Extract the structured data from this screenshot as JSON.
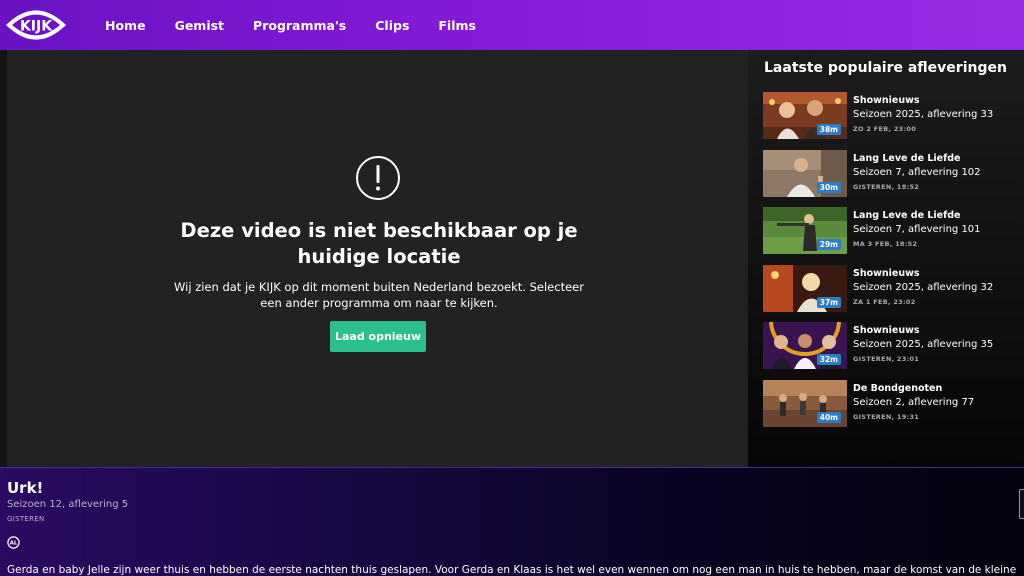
{
  "header": {
    "logo_icon": "kijk-logo",
    "nav": [
      "Home",
      "Gemist",
      "Programma's",
      "Clips",
      "Films"
    ]
  },
  "player": {
    "error_icon": "exclamation-circle-icon",
    "title": "Deze video is niet beschikbaar op je huidige locatie",
    "message": "Wij zien dat je KIJK op dit moment buiten Nederland bezoekt. Selecteer een ander programma om naar te kijken.",
    "button": "Laad opnieuw",
    "button_color": "#2bbf8e"
  },
  "sidebar": {
    "title": "Laatste populaire afleveringen",
    "episodes": [
      {
        "show": "Shownieuws",
        "season": "Seizoen 2025, aflevering 33",
        "date": "ZO 2 FEB, 23:00",
        "duration": "38m"
      },
      {
        "show": "Lang Leve de Liefde",
        "season": "Seizoen 7, aflevering 102",
        "date": "GISTEREN, 18:52",
        "duration": "30m"
      },
      {
        "show": "Lang Leve de Liefde",
        "season": "Seizoen 7, aflevering 101",
        "date": "MA 3 FEB, 18:52",
        "duration": "29m"
      },
      {
        "show": "Shownieuws",
        "season": "Seizoen 2025, aflevering 32",
        "date": "ZA 1 FEB, 23:02",
        "duration": "37m"
      },
      {
        "show": "Shownieuws",
        "season": "Seizoen 2025, aflevering 35",
        "date": "GISTEREN, 23:01",
        "duration": "32m"
      },
      {
        "show": "De Bondgenoten",
        "season": "Seizoen 2, aflevering 77",
        "date": "GISTEREN, 19:31",
        "duration": "40m"
      }
    ],
    "duration_badge_color": "#2a7ec8"
  },
  "program": {
    "title": "Urk!",
    "season": "Seizoen 12, aflevering 5",
    "date": "GISTEREN",
    "rating_icon": "rating-al-icon",
    "rating": "AL",
    "description": "Gerda en baby Jelle zijn weer thuis en hebben de eerste nachten thuis geslapen. Voor Gerda en Klaas is het wel even wennen om nog een man in huis te hebben, maar de komst van de kleine"
  }
}
